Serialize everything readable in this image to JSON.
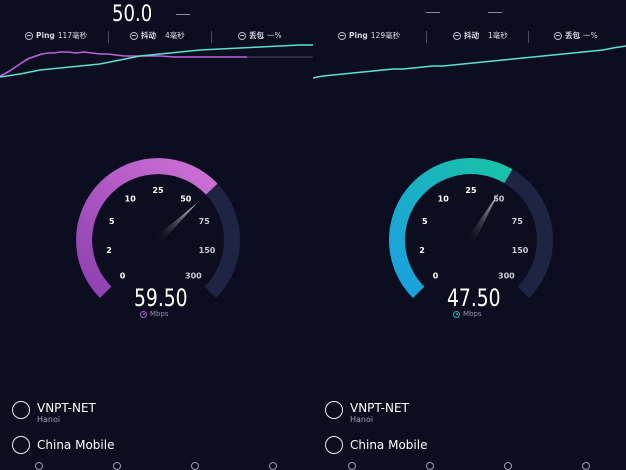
{
  "panels": [
    {
      "id": "left",
      "top_value": "50.0",
      "stats": {
        "ping_label": "Ping",
        "ping_value": "117毫秒",
        "jitter_label": "抖动",
        "jitter_value": "4毫秒",
        "loss_label": "丢包",
        "loss_value": "一%"
      },
      "gauge": {
        "ticks": [
          "0",
          "2",
          "5",
          "10",
          "25",
          "50",
          "75",
          "150",
          "300"
        ],
        "reading": 59.5,
        "speed": "59.50",
        "unit": "Mbps",
        "accent": "#b45cc9"
      },
      "isp": {
        "name": "VNPT-NET",
        "location": "Hanoi"
      },
      "network": {
        "name": "China Mobile"
      }
    },
    {
      "id": "right",
      "top_value": "",
      "stats": {
        "ping_label": "Ping",
        "ping_value": "129毫秒",
        "jitter_label": "抖动",
        "jitter_value": "1毫秒",
        "loss_label": "丢包",
        "loss_value": "一%"
      },
      "gauge": {
        "ticks": [
          "0",
          "2",
          "5",
          "10",
          "25",
          "50",
          "75",
          "150",
          "300"
        ],
        "reading": 47.5,
        "speed": "47.50",
        "unit": "Mbps",
        "accent": "#17b6c4"
      },
      "isp": {
        "name": "VNPT-NET",
        "location": "Hanoi"
      },
      "network": {
        "name": "China Mobile"
      }
    }
  ],
  "colors": {
    "background": "#0c0e1f",
    "graph_line": "#5be0d0",
    "graph_purple": "#c060e0",
    "gauge_track": "#1f2442"
  }
}
